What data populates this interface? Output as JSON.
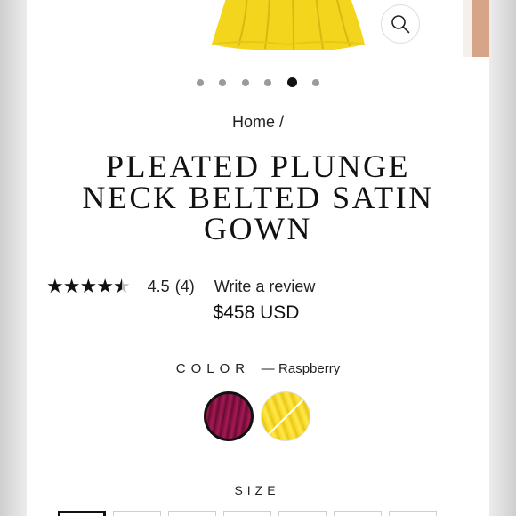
{
  "gallery": {
    "zoom_icon": "search-icon",
    "slide_count": 6,
    "active_slide": 5
  },
  "breadcrumb": {
    "home_label": "Home",
    "separator": "/"
  },
  "product": {
    "title": "PLEATED PLUNGE NECK BELTED SATIN GOWN",
    "rating": {
      "stars_filled": 4.5,
      "value": "4.5",
      "count": "(4)",
      "write_review_label": "Write a review"
    },
    "price": "$458 USD",
    "color": {
      "label": "COLOR",
      "separator": "—",
      "selected_value": "Raspberry",
      "options": [
        {
          "name": "raspberry",
          "color": "#8e1445",
          "selected": true
        },
        {
          "name": "yellow",
          "color": "#f5d624",
          "selected": false
        }
      ]
    },
    "size": {
      "label": "SIZE"
    }
  },
  "colors": {
    "text": "#111111",
    "dot_inactive": "#9a9a9a",
    "dot_active": "#111111"
  }
}
